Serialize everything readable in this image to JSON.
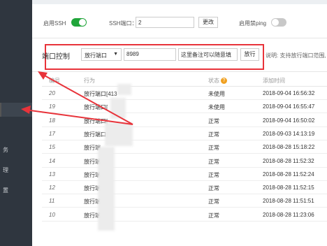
{
  "ssh": {
    "enable_label": "启用SSH",
    "enabled": true,
    "port_label": "SSH端口：",
    "port_value": "2",
    "change_button": "更改",
    "ping_label": "启用禁ping",
    "ping_enabled": false
  },
  "port_control": {
    "title": "端口控制",
    "action_select": "放行端口",
    "port_input": "8989",
    "remark_input": "这里备注可以随意填",
    "submit_button": "放行",
    "hint": "说明: 支持放行端口范围,"
  },
  "sidebar": {
    "items": [
      "务",
      "理",
      "置"
    ]
  },
  "table": {
    "headers": [
      "编号",
      "行为",
      "状态",
      "添加时间"
    ],
    "rows": [
      {
        "id": "20",
        "action": "放行端口[413",
        "status": "未使用",
        "time": "2018-09-04 16:56:32"
      },
      {
        "id": "19",
        "action": "放行端口[",
        "status": "未使用",
        "time": "2018-09-04 16:55:47"
      },
      {
        "id": "18",
        "action": "放行端口[",
        "status": "正常",
        "time": "2018-09-04 16:50:02"
      },
      {
        "id": "17",
        "action": "放行端口[        ]",
        "status": "正常",
        "time": "2018-09-03 14:13:19"
      },
      {
        "id": "15",
        "action": "放行端",
        "status": "正常",
        "time": "2018-08-28 15:18:22"
      },
      {
        "id": "14",
        "action": "放行端",
        "status": "正常",
        "time": "2018-08-28 11:52:32"
      },
      {
        "id": "13",
        "action": "放行端",
        "status": "正常",
        "time": "2018-08-28 11:52:24"
      },
      {
        "id": "12",
        "action": "放行端[",
        "status": "正常",
        "time": "2018-08-28 11:52:15"
      },
      {
        "id": "11",
        "action": "放行端[",
        "status": "正常",
        "time": "2018-08-28 11:51:51"
      },
      {
        "id": "10",
        "action": "放行端[    5]",
        "status": "正常",
        "time": "2018-08-28 11:23:06"
      }
    ]
  },
  "colors": {
    "accent_green": "#20a53a",
    "highlight_red": "#e8333a",
    "sidebar_bg": "#2f363f"
  }
}
